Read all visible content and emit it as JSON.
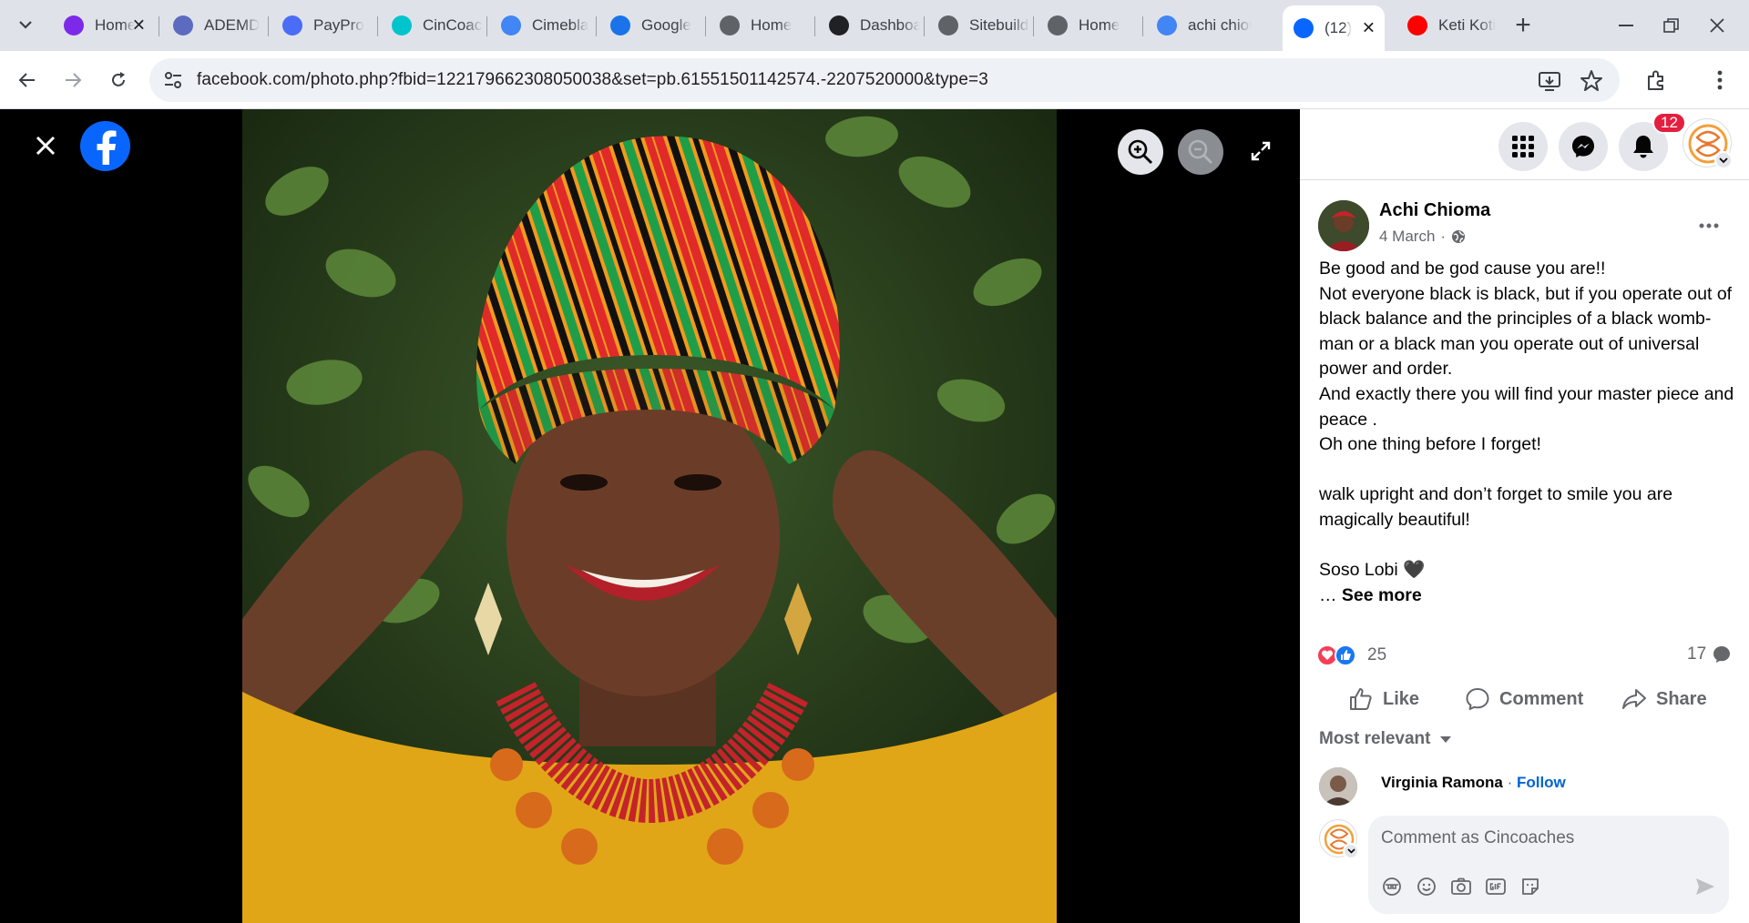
{
  "browser": {
    "tabs": [
      {
        "label": "Home",
        "favicon": "canva-circle-icon",
        "color": "#7d2ae8",
        "has_close": true
      },
      {
        "label": "ADEMD",
        "favicon": "printer-app-icon",
        "color": "#5c6bc0",
        "has_close": false
      },
      {
        "label": "PayPro",
        "favicon": "payment-icon",
        "color": "#4a6cf7",
        "has_close": false
      },
      {
        "label": "CinCoaches",
        "favicon": "canva-circle-icon",
        "color": "#00c4cc",
        "has_close": false
      },
      {
        "label": "Cimebla",
        "favicon": "document-icon",
        "color": "#4285f4",
        "has_close": false
      },
      {
        "label": "Google",
        "favicon": "calendar-icon",
        "color": "#1a73e8",
        "has_close": false
      },
      {
        "label": "Home",
        "favicon": "globe-icon",
        "color": "#5f6368",
        "has_close": false
      },
      {
        "label": "Dashboard",
        "favicon": "y-letter-icon",
        "color": "#202124",
        "has_close": false
      },
      {
        "label": "Sitebuilder",
        "favicon": "globe-icon",
        "color": "#5f6368",
        "has_close": false
      },
      {
        "label": "Home",
        "favicon": "globe-icon",
        "color": "#5f6368",
        "has_close": false
      },
      {
        "label": "achi chioma",
        "favicon": "google-g-icon",
        "color": "#4285f4",
        "has_close": false
      },
      {
        "label": "(12)",
        "favicon": "facebook-icon",
        "color": "#0866ff",
        "has_close": true,
        "active": true
      },
      {
        "label": "Keti Koti",
        "favicon": "youtube-icon",
        "color": "#ff0000",
        "has_close": false
      }
    ],
    "url": "facebook.com/photo.php?fbid=122179662308050038&set=pb.61551501142574.-2207520000&type=3"
  },
  "panel": {
    "notification_count": "12",
    "post": {
      "author": "Achi Chioma",
      "date": "4 March",
      "separator": "·",
      "lines": [
        "Be good and be god cause you are!!",
        "Not everyone black is black, but if you operate out of black balance and the principles of a black womb-man or a black man you operate out of universal power and order.",
        "And exactly there you will find your master piece and peace .",
        "Oh one thing before I forget!",
        "",
        "walk upright and don’t forget to smile you are magically beautiful!",
        "",
        "Soso Lobi 🖤"
      ],
      "see_more_prefix": "… ",
      "see_more": "See more",
      "reaction_count": "25",
      "comment_count": "17"
    },
    "actions": {
      "like": "Like",
      "comment": "Comment",
      "share": "Share"
    },
    "sort_label": "Most relevant",
    "top_comment": {
      "name": "Virginia Ramona",
      "dot": " · ",
      "follow": "Follow"
    },
    "composer": {
      "placeholder": "Comment as Cincoaches"
    }
  },
  "colors": {
    "facebook_blue": "#0866ff",
    "badge_red": "#e41e3f",
    "link_blue": "#0064d1"
  }
}
